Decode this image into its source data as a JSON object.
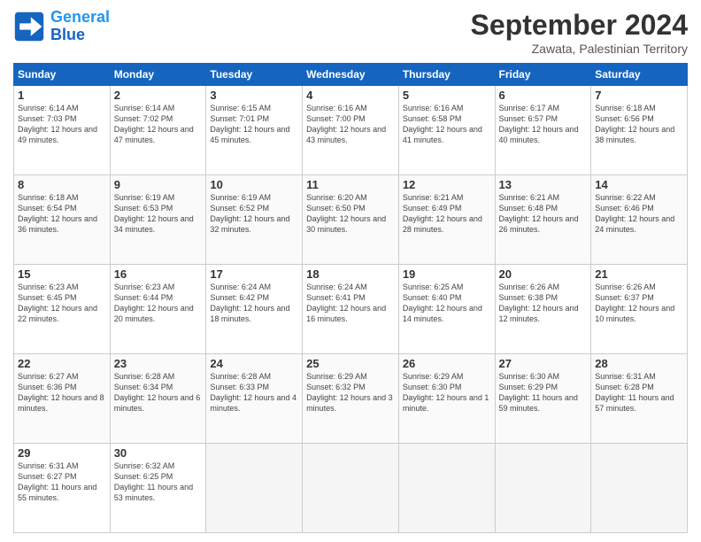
{
  "header": {
    "logo_line1": "General",
    "logo_line2": "Blue",
    "month": "September 2024",
    "location": "Zawata, Palestinian Territory"
  },
  "weekdays": [
    "Sunday",
    "Monday",
    "Tuesday",
    "Wednesday",
    "Thursday",
    "Friday",
    "Saturday"
  ],
  "weeks": [
    [
      {
        "day": "1",
        "sunrise": "6:14 AM",
        "sunset": "7:03 PM",
        "daylight": "12 hours and 49 minutes."
      },
      {
        "day": "2",
        "sunrise": "6:14 AM",
        "sunset": "7:02 PM",
        "daylight": "12 hours and 47 minutes."
      },
      {
        "day": "3",
        "sunrise": "6:15 AM",
        "sunset": "7:01 PM",
        "daylight": "12 hours and 45 minutes."
      },
      {
        "day": "4",
        "sunrise": "6:16 AM",
        "sunset": "7:00 PM",
        "daylight": "12 hours and 43 minutes."
      },
      {
        "day": "5",
        "sunrise": "6:16 AM",
        "sunset": "6:58 PM",
        "daylight": "12 hours and 41 minutes."
      },
      {
        "day": "6",
        "sunrise": "6:17 AM",
        "sunset": "6:57 PM",
        "daylight": "12 hours and 40 minutes."
      },
      {
        "day": "7",
        "sunrise": "6:18 AM",
        "sunset": "6:56 PM",
        "daylight": "12 hours and 38 minutes."
      }
    ],
    [
      {
        "day": "8",
        "sunrise": "6:18 AM",
        "sunset": "6:54 PM",
        "daylight": "12 hours and 36 minutes."
      },
      {
        "day": "9",
        "sunrise": "6:19 AM",
        "sunset": "6:53 PM",
        "daylight": "12 hours and 34 minutes."
      },
      {
        "day": "10",
        "sunrise": "6:19 AM",
        "sunset": "6:52 PM",
        "daylight": "12 hours and 32 minutes."
      },
      {
        "day": "11",
        "sunrise": "6:20 AM",
        "sunset": "6:50 PM",
        "daylight": "12 hours and 30 minutes."
      },
      {
        "day": "12",
        "sunrise": "6:21 AM",
        "sunset": "6:49 PM",
        "daylight": "12 hours and 28 minutes."
      },
      {
        "day": "13",
        "sunrise": "6:21 AM",
        "sunset": "6:48 PM",
        "daylight": "12 hours and 26 minutes."
      },
      {
        "day": "14",
        "sunrise": "6:22 AM",
        "sunset": "6:46 PM",
        "daylight": "12 hours and 24 minutes."
      }
    ],
    [
      {
        "day": "15",
        "sunrise": "6:23 AM",
        "sunset": "6:45 PM",
        "daylight": "12 hours and 22 minutes."
      },
      {
        "day": "16",
        "sunrise": "6:23 AM",
        "sunset": "6:44 PM",
        "daylight": "12 hours and 20 minutes."
      },
      {
        "day": "17",
        "sunrise": "6:24 AM",
        "sunset": "6:42 PM",
        "daylight": "12 hours and 18 minutes."
      },
      {
        "day": "18",
        "sunrise": "6:24 AM",
        "sunset": "6:41 PM",
        "daylight": "12 hours and 16 minutes."
      },
      {
        "day": "19",
        "sunrise": "6:25 AM",
        "sunset": "6:40 PM",
        "daylight": "12 hours and 14 minutes."
      },
      {
        "day": "20",
        "sunrise": "6:26 AM",
        "sunset": "6:38 PM",
        "daylight": "12 hours and 12 minutes."
      },
      {
        "day": "21",
        "sunrise": "6:26 AM",
        "sunset": "6:37 PM",
        "daylight": "12 hours and 10 minutes."
      }
    ],
    [
      {
        "day": "22",
        "sunrise": "6:27 AM",
        "sunset": "6:36 PM",
        "daylight": "12 hours and 8 minutes."
      },
      {
        "day": "23",
        "sunrise": "6:28 AM",
        "sunset": "6:34 PM",
        "daylight": "12 hours and 6 minutes."
      },
      {
        "day": "24",
        "sunrise": "6:28 AM",
        "sunset": "6:33 PM",
        "daylight": "12 hours and 4 minutes."
      },
      {
        "day": "25",
        "sunrise": "6:29 AM",
        "sunset": "6:32 PM",
        "daylight": "12 hours and 3 minutes."
      },
      {
        "day": "26",
        "sunrise": "6:29 AM",
        "sunset": "6:30 PM",
        "daylight": "12 hours and 1 minute."
      },
      {
        "day": "27",
        "sunrise": "6:30 AM",
        "sunset": "6:29 PM",
        "daylight": "11 hours and 59 minutes."
      },
      {
        "day": "28",
        "sunrise": "6:31 AM",
        "sunset": "6:28 PM",
        "daylight": "11 hours and 57 minutes."
      }
    ],
    [
      {
        "day": "29",
        "sunrise": "6:31 AM",
        "sunset": "6:27 PM",
        "daylight": "11 hours and 55 minutes."
      },
      {
        "day": "30",
        "sunrise": "6:32 AM",
        "sunset": "6:25 PM",
        "daylight": "11 hours and 53 minutes."
      },
      null,
      null,
      null,
      null,
      null
    ]
  ]
}
